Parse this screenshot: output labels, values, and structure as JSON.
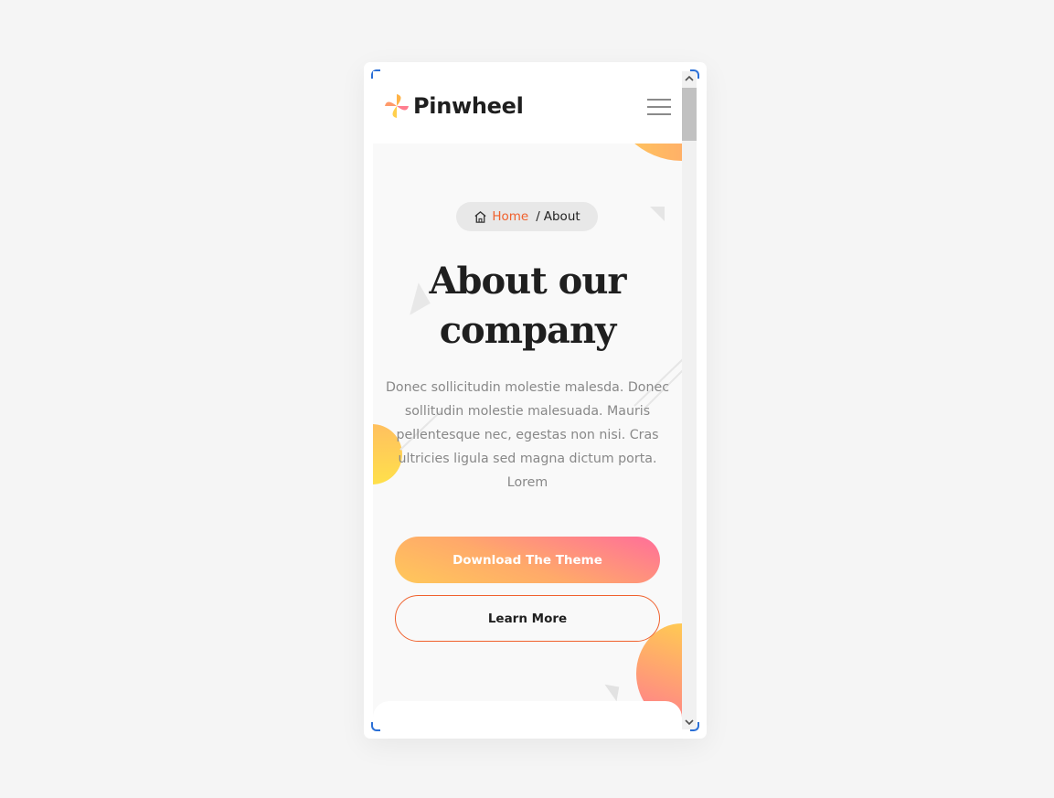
{
  "header": {
    "logo_text": "Pinwheel",
    "logo_icon": "pinwheel-icon",
    "menu_icon": "hamburger-menu-icon"
  },
  "breadcrumb": {
    "home_icon": "home-icon",
    "home_label": "Home",
    "separator": "/",
    "current_label": "About"
  },
  "hero": {
    "title_line1": "About our",
    "title_line2": "company",
    "description": "Donec sollicitudin molestie malesda. Donec sollitudin molestie malesuada. Mauris pellentesque nec, egestas non nisi. Cras ultricies ligula sed magna dictum porta. Lorem"
  },
  "actions": {
    "primary_label": "Download The Theme",
    "secondary_label": "Learn More"
  },
  "colors": {
    "accent": "#f0612d",
    "gradient_pink": "#ff6e9a",
    "gradient_yellow": "#ffc85a",
    "title_text": "#1f1f1f",
    "body_text": "#888888"
  }
}
